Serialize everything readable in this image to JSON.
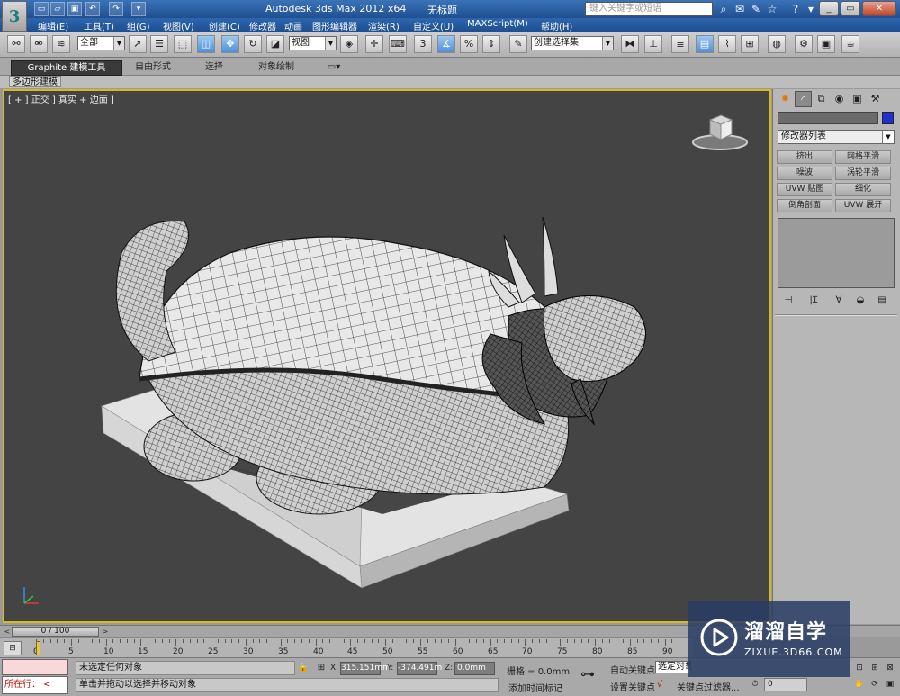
{
  "window": {
    "title": "Autodesk 3ds Max  2012 x64",
    "file_name": "无标题",
    "search_placeholder": "键入关键字或短语",
    "app_logo": "3"
  },
  "menu": {
    "items": [
      "编辑(E)",
      "工具(T)",
      "组(G)",
      "视图(V)",
      "创建(C)",
      "修改器",
      "动画",
      "图形编辑器",
      "渲染(R)",
      "自定义(U)",
      "MAXScript(M)",
      "帮助(H)"
    ]
  },
  "toolbar": {
    "selection_filter": "全部",
    "ref_coord": "视图",
    "snap_angle_label": "3",
    "named_selection": "创建选择集"
  },
  "ribbon": {
    "tabs": [
      "Graphite 建模工具",
      "自由形式",
      "选择",
      "对象绘制"
    ],
    "subtab": "多边形建模"
  },
  "viewport": {
    "label": "[ + ] 正交 ] 真实 + 边面 ]"
  },
  "command_panel": {
    "modifier_list": "修改器列表",
    "buttons": [
      "挤出",
      "网格平滑",
      "噪波",
      "涡轮平滑",
      "UVW 贴图",
      "细化",
      "倒角剖面",
      "UVW 展开"
    ]
  },
  "time_slider": {
    "range": "0 / 100"
  },
  "track": {
    "ticks": [
      "0",
      "5",
      "10",
      "15",
      "20",
      "25",
      "30",
      "35",
      "40",
      "45",
      "50",
      "55",
      "60",
      "65",
      "70",
      "75",
      "80",
      "85",
      "90"
    ]
  },
  "status": {
    "listener": "所在行：",
    "selection": "未选定任何对象",
    "hint": "单击并拖动以选择并移动对象",
    "x_label": "X:",
    "x_value": "315.151mm",
    "y_label": "Y:",
    "y_value": "-374.491m",
    "z_label": "Z:",
    "z_value": "0.0mm",
    "grid": "栅格 = 0.0mm",
    "auto_key": "自动关键点",
    "sel_filter": "选定对象",
    "set_key": "设置关键点",
    "key_filters": "关键点过滤器...",
    "add_time_tag": "添加时间标记",
    "frame": "0"
  },
  "watermark": {
    "title": "溜溜自学",
    "url": "ZIXUE.3D66.COM"
  },
  "colors": {
    "viewport_bg": "#444444",
    "viewport_border": "#d9b91c",
    "object_color": "#2030d0",
    "title_bar": "#2f66ad"
  },
  "icons": {
    "app_logo": "3ds-max-logo-icon",
    "viewcube": "viewcube-icon",
    "axis": "axis-tripod-icon",
    "key": "key-icon",
    "watermark_logo": "play-logo-icon"
  }
}
